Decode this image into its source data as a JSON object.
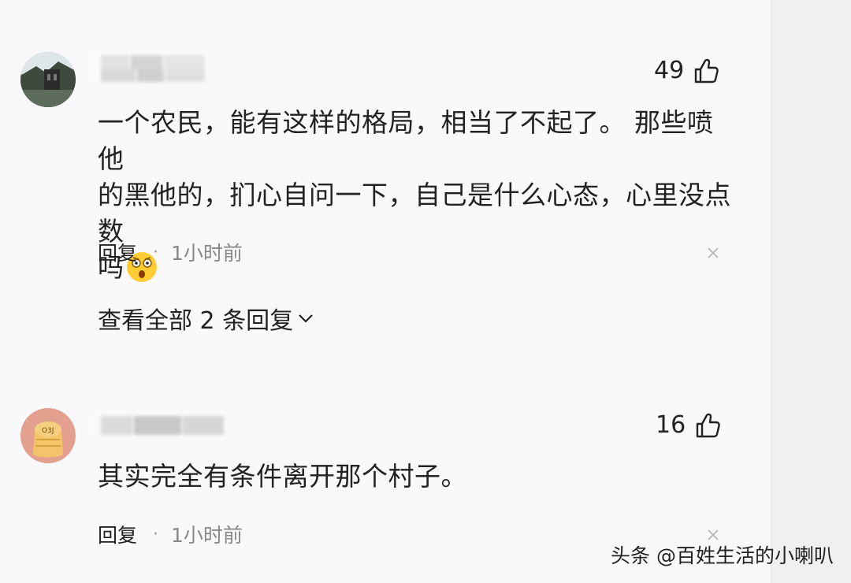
{
  "comments": [
    {
      "likes": "49",
      "text_lines": [
        "一个农民，能有这样的格局，相当了不起了。 那些喷他",
        "的黑他的，扪心自问一下，自己是什么心态，心里没点数",
        "吗"
      ],
      "emoji": "dizzy-face-emoji",
      "reply_label": "回复",
      "separator": "·",
      "time": "1小时前",
      "view_replies": "查看全部 2 条回复"
    },
    {
      "likes": "16",
      "text_lines": [
        "其实完全有条件离开那个村子。"
      ],
      "reply_label": "回复",
      "separator": "·",
      "time": "1小时前"
    }
  ],
  "watermark": "头条 @百姓生活的小喇叭",
  "icons": {
    "like": "thumbs-up-icon",
    "close": "close-icon",
    "chevron": "chevron-down-icon"
  }
}
